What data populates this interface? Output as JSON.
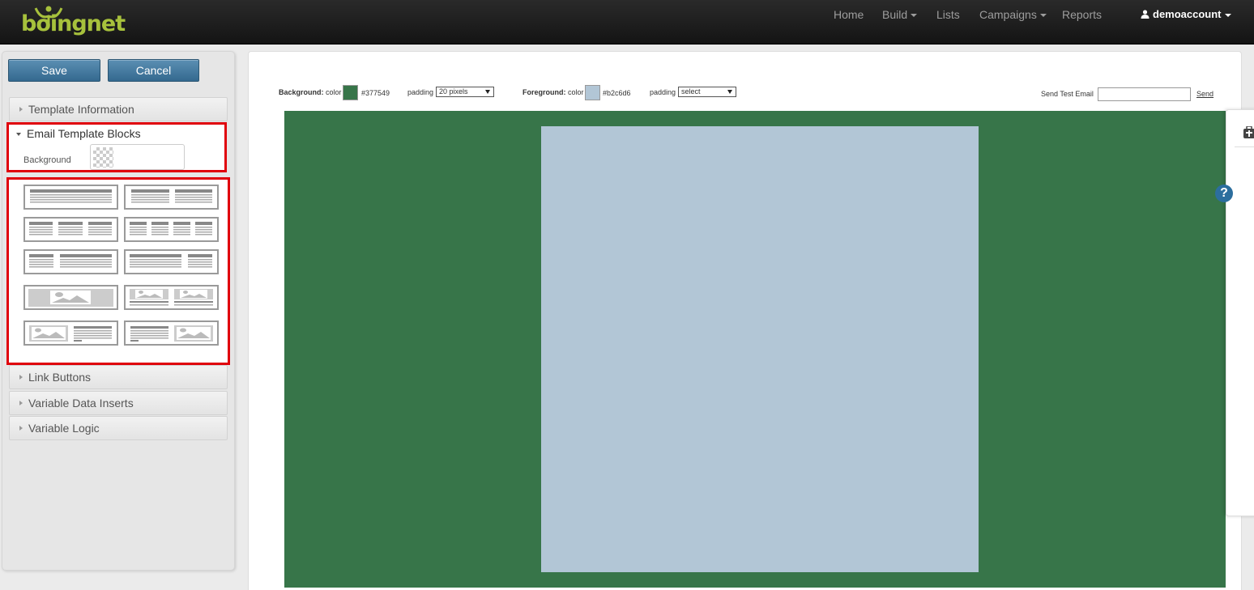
{
  "brand": {
    "logo_text": "boingnet",
    "logo_color": "#a7c13c"
  },
  "nav": {
    "items": [
      {
        "label": "Home",
        "has_caret": false
      },
      {
        "label": "Build",
        "has_caret": true
      },
      {
        "label": "Lists",
        "has_caret": false
      },
      {
        "label": "Campaigns",
        "has_caret": true
      },
      {
        "label": "Reports",
        "has_caret": false
      }
    ],
    "user": {
      "label": "demoaccount",
      "icon": "user-icon"
    }
  },
  "sidebar": {
    "save_label": "Save",
    "cancel_label": "Cancel",
    "sections": {
      "template_information": "Template Information",
      "email_template_blocks": "Email Template Blocks",
      "link_buttons": "Link Buttons",
      "variable_data_inserts": "Variable Data Inserts",
      "variable_logic": "Variable Logic"
    },
    "background_label": "Background",
    "blocks": [
      "one-column-text",
      "two-column-text",
      "three-column-text",
      "four-column-text",
      "narrow-left-wide-right-text",
      "wide-left-narrow-right-text",
      "full-width-image",
      "two-image-with-text",
      "image-left-text-right",
      "text-left-image-right"
    ]
  },
  "toolbar": {
    "background_label": "Background:",
    "background_color_label": "color",
    "background_color": "#377549",
    "background_padding_label": "padding",
    "background_padding_value": "20 pixels",
    "foreground_label": "Foreground:",
    "foreground_color_label": "color",
    "foreground_color": "#b2c6d6",
    "foreground_padding_label": "padding",
    "foreground_padding_value": "select",
    "send_test_label": "Send Test Email",
    "send_test_value": "",
    "send_link": "Send"
  },
  "canvas": {
    "background_color": "#377549",
    "foreground_color": "#b2c6d6"
  },
  "help": {
    "label": "?"
  },
  "colors": {
    "accent_red": "#e0000b",
    "button_blue": "#34698f"
  }
}
